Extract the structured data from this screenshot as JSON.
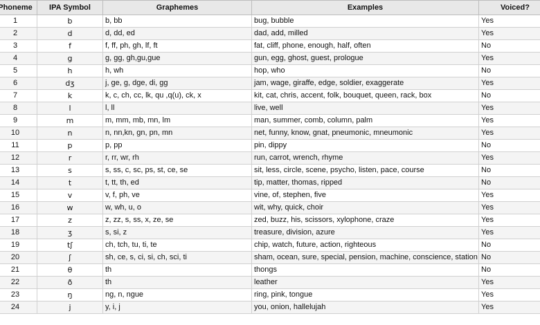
{
  "headers": [
    "Phoneme",
    "IPA Symbol",
    "Graphemes",
    "Examples",
    "Voiced?"
  ],
  "rows": [
    {
      "num": "1",
      "ipa": "b",
      "graphemes": "b, bb",
      "examples": "bug, bubble",
      "voiced": "Yes"
    },
    {
      "num": "2",
      "ipa": "d",
      "graphemes": "d, dd, ed",
      "examples": "dad, add, milled",
      "voiced": "Yes"
    },
    {
      "num": "3",
      "ipa": "f",
      "graphemes": "f, ff, ph, gh, lf, ft",
      "examples": "fat, cliff, phone, enough, half, often",
      "voiced": "No"
    },
    {
      "num": "4",
      "ipa": "g",
      "graphemes": "g, gg, gh,gu,gue",
      "examples": "gun, egg, ghost, guest, prologue",
      "voiced": "Yes"
    },
    {
      "num": "5",
      "ipa": "h",
      "graphemes": "h, wh",
      "examples": "hop, who",
      "voiced": "No"
    },
    {
      "num": "6",
      "ipa": "dʒ",
      "graphemes": "j, ge, g, dge, di, gg",
      "examples": "jam, wage, giraffe, edge, soldier, exaggerate",
      "voiced": "Yes"
    },
    {
      "num": "7",
      "ipa": "k",
      "graphemes": "k, c, ch, cc, lk, qu ,q(u), ck, x",
      "examples": "kit, cat, chris, accent, folk, bouquet, queen, rack, box",
      "voiced": "No"
    },
    {
      "num": "8",
      "ipa": "l",
      "graphemes": "l, ll",
      "examples": "live, well",
      "voiced": "Yes"
    },
    {
      "num": "9",
      "ipa": "m",
      "graphemes": "m, mm, mb, mn, lm",
      "examples": "man, summer, comb, column, palm",
      "voiced": "Yes"
    },
    {
      "num": "10",
      "ipa": "n",
      "graphemes": "n, nn,kn, gn, pn, mn",
      "examples": "net, funny, know, gnat, pneumonic, mneumonic",
      "voiced": "Yes"
    },
    {
      "num": "11",
      "ipa": "p",
      "graphemes": "p, pp",
      "examples": "pin, dippy",
      "voiced": "No"
    },
    {
      "num": "12",
      "ipa": "r",
      "graphemes": "r, rr, wr, rh",
      "examples": "run, carrot, wrench, rhyme",
      "voiced": "Yes"
    },
    {
      "num": "13",
      "ipa": "s",
      "graphemes": "s, ss, c, sc, ps, st, ce, se",
      "examples": "sit, less, circle, scene, psycho, listen, pace, course",
      "voiced": "No"
    },
    {
      "num": "14",
      "ipa": "t",
      "graphemes": "t, tt, th, ed",
      "examples": "tip, matter, thomas, ripped",
      "voiced": "No"
    },
    {
      "num": "15",
      "ipa": "v",
      "graphemes": "v, f, ph, ve",
      "examples": "vine, of, stephen, five",
      "voiced": "Yes"
    },
    {
      "num": "16",
      "ipa": "w",
      "graphemes": "w, wh, u, o",
      "examples": "wit, why, quick, choir",
      "voiced": "Yes"
    },
    {
      "num": "17",
      "ipa": "z",
      "graphemes": "z, zz, s, ss, x, ze, se",
      "examples": "zed, buzz, his, scissors, xylophone, craze",
      "voiced": "Yes"
    },
    {
      "num": "18",
      "ipa": "ʒ",
      "graphemes": "s, si, z",
      "examples": "treasure, division, azure",
      "voiced": "Yes"
    },
    {
      "num": "19",
      "ipa": "tʃ",
      "graphemes": "ch, tch, tu, ti, te",
      "examples": "chip, watch, future, action, righteous",
      "voiced": "No"
    },
    {
      "num": "20",
      "ipa": "ʃ",
      "graphemes": "sh, ce, s, ci, si, ch, sci, ti",
      "examples": "sham, ocean, sure, special, pension, machine, conscience, station",
      "voiced": "No"
    },
    {
      "num": "21",
      "ipa": "θ",
      "graphemes": "th",
      "examples": "thongs",
      "voiced": "No"
    },
    {
      "num": "22",
      "ipa": "ð",
      "graphemes": "th",
      "examples": "leather",
      "voiced": "Yes"
    },
    {
      "num": "23",
      "ipa": "ŋ",
      "graphemes": "ng, n, ngue",
      "examples": "ring, pink, tongue",
      "voiced": "Yes"
    },
    {
      "num": "24",
      "ipa": "j",
      "graphemes": "y, i, j",
      "examples": "you, onion, hallelujah",
      "voiced": "Yes"
    }
  ]
}
